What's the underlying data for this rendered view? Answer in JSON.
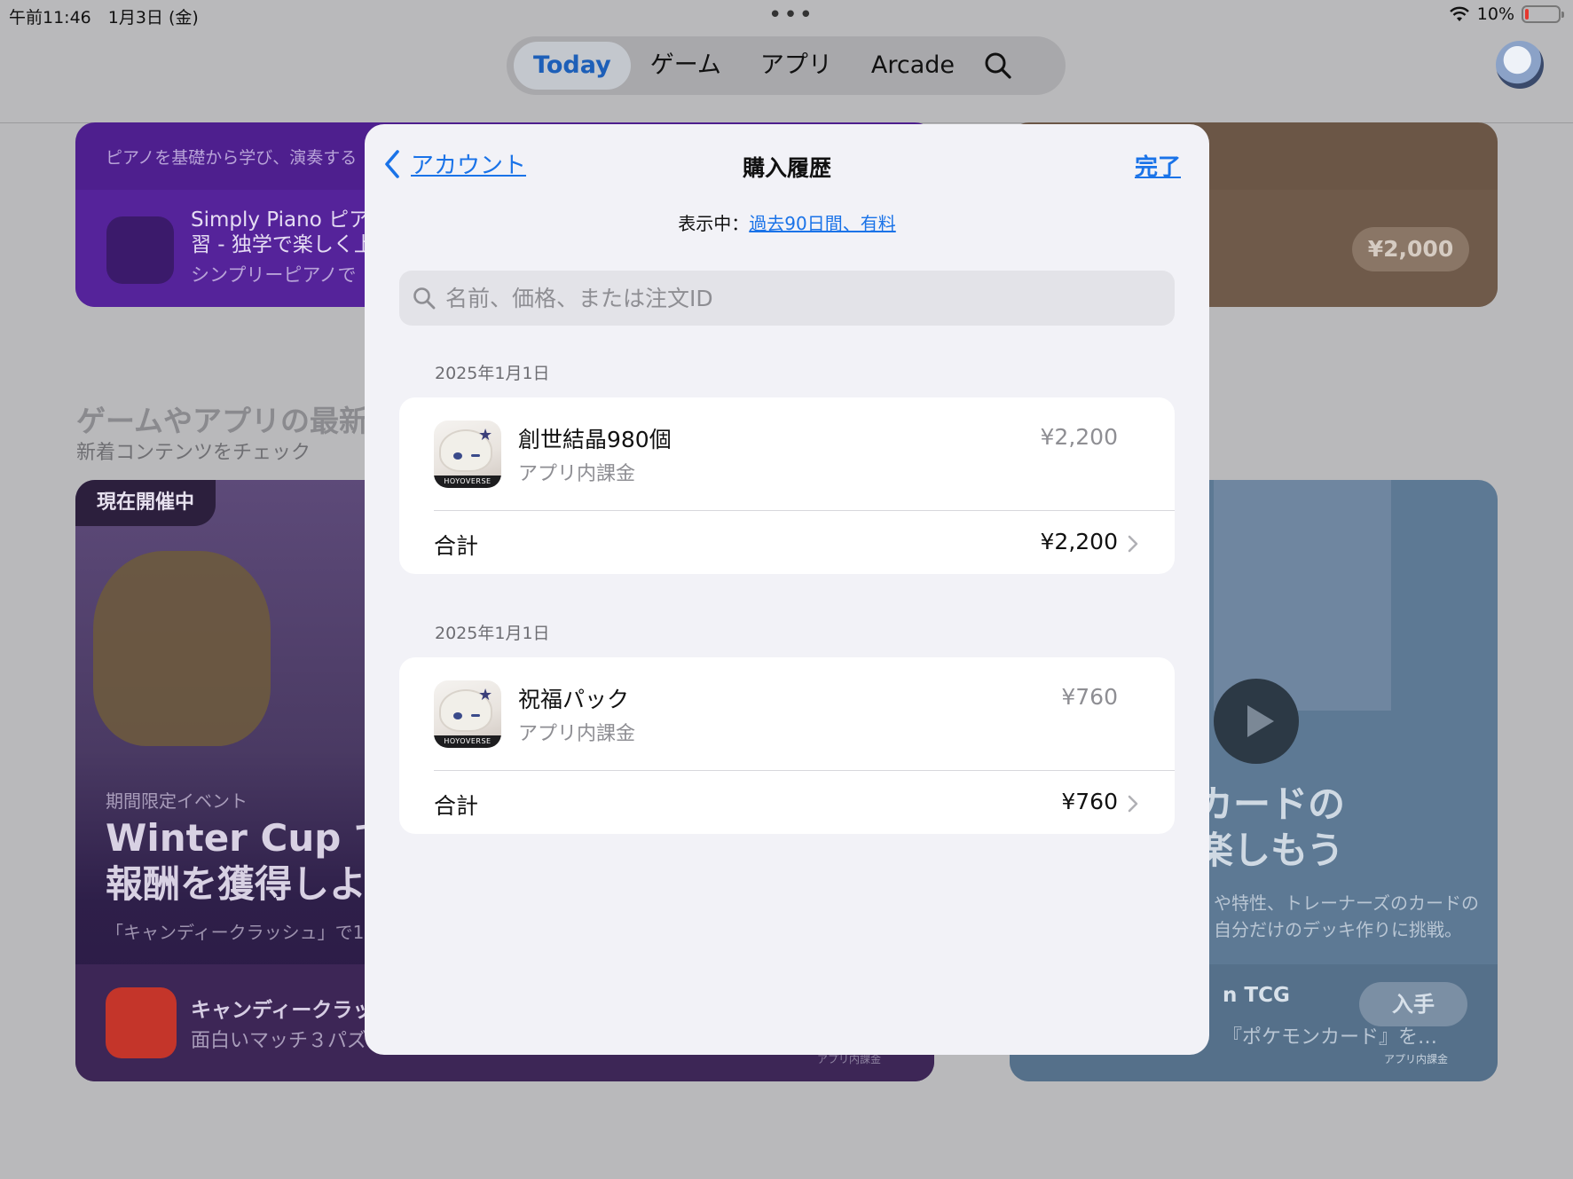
{
  "status_bar": {
    "time_date": "午前11:46　1月3日 (金)",
    "battery": "10%",
    "battery_level": 0.1
  },
  "top_nav": {
    "tabs": [
      {
        "label": "Today",
        "active": true
      },
      {
        "label": "ゲーム",
        "active": false
      },
      {
        "label": "アプリ",
        "active": false
      },
      {
        "label": "Arcade",
        "active": false
      }
    ],
    "search_icon": "search-icon"
  },
  "background": {
    "card1": {
      "subtitle": "ピアノを基礎から学び、演奏する",
      "app_name": "Simply Piano ピア\n習 - 独学で楽しく上",
      "app_sub": "シンプリーピアノで"
    },
    "card2": {
      "price": "¥2,000"
    },
    "section_title": "ゲームやアプリの最新",
    "section_sub": "新着コンテンツをチェック",
    "card3": {
      "badge": "現在開催中",
      "kicker": "期間限定イベント",
      "headline": "Winter Cup で\n報酬を獲得しよ",
      "desc": "「キャンディークラッシュ」で1年",
      "app_name": "キャンディークラッ",
      "app_sub": "面白いマッチ３パズ",
      "tiny": "アプリ内課金"
    },
    "card4": {
      "headline": "カードの\n楽しもう",
      "desc": "や特性、トレーナーズのカードの\n自分だけのデッキ作りに挑戦。",
      "app_name": "n TCG",
      "app_sub": "『ポケモンカード』を…",
      "get": "入手",
      "tiny": "アプリ内課金"
    }
  },
  "sheet": {
    "back_label": "アカウント",
    "title": "購入履歴",
    "done_label": "完了",
    "filter_prefix": "表示中：",
    "filter_link": "過去90日間、有料",
    "search_placeholder": "名前、価格、または注文ID",
    "groups": [
      {
        "date": "2025年1月1日",
        "item_name": "創世結晶980個",
        "item_type": "アプリ内課金",
        "item_price": "¥2,200",
        "total_label": "合計",
        "total_value": "¥2,200"
      },
      {
        "date": "2025年1月1日",
        "item_name": "祝福パック",
        "item_type": "アプリ内課金",
        "item_price": "¥760",
        "total_label": "合計",
        "total_value": "¥760"
      }
    ],
    "icon_logo_text": "HOYOVERSE"
  },
  "colors": {
    "accent": "#1a73e8",
    "sheet_bg": "#f2f2f7",
    "battery_low": "#e5382f"
  }
}
